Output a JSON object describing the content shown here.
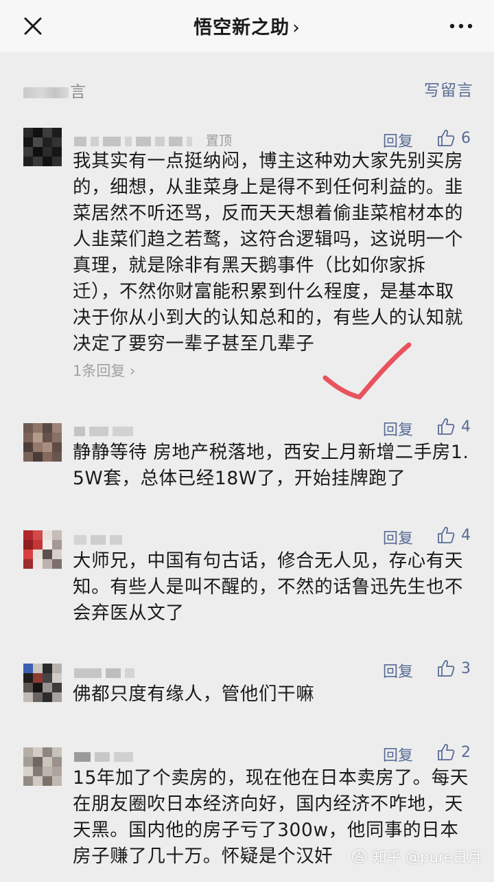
{
  "nav": {
    "title": "悟空新之助",
    "title_chevron": "›"
  },
  "section": {
    "label_suffix": "言",
    "write_comment": "写留言"
  },
  "comments": [
    {
      "pinned_label": "置顶",
      "reply_label": "回复",
      "likes": "6",
      "text": "我其实有一点挺纳闷，博主这种劝大家先别买房的，细想，从韭菜身上是得不到任何利益的。韭菜居然不听还骂，反而天天想着偷韭菜棺材本的人韭菜们趋之若鹜，这符合逻辑吗，这说明一个真理，就是除非有黑天鹅事件（比如你家拆迁），不然你财富能积累到什么程度，是基本取决于你从小到大的认知总和的，有些人的认知就决定了要穷一辈子甚至几辈子",
      "reply_count": "1条回复"
    },
    {
      "reply_label": "回复",
      "likes": "4",
      "text": "静静等待 房地产税落地，西安上月新增二手房1.5W套，总体已经18W了，开始挂牌跑了"
    },
    {
      "reply_label": "回复",
      "likes": "4",
      "text": "大师兄，中国有句古话，修合无人见，存心有天知。有些人是叫不醒的，不然的话鲁迅先生也不会弃医从文了"
    },
    {
      "reply_label": "回复",
      "likes": "3",
      "text": "佛都只度有缘人，管他们干嘛"
    },
    {
      "reply_label": "回复",
      "likes": "2",
      "text": "15年加了个卖房的，现在他在日本卖房了。每天在朋友圈吹日本经济向好，国内经济不咋地，天天黑。国内他的房子亏了300w，他同事的日本房子赚了几十万。怀疑是个汉奸"
    }
  ],
  "watermark": {
    "text": "知乎 @pure日月",
    "emoji": "😨"
  },
  "colors": {
    "link": "#576b95",
    "annotation_check": "#e8535d"
  },
  "icons": [
    "close-icon",
    "more-icon",
    "thumbs-up-icon",
    "chevron-right-icon",
    "check-mark"
  ]
}
